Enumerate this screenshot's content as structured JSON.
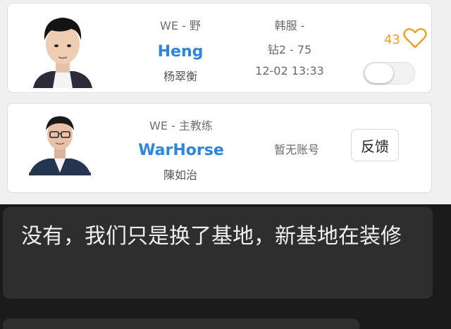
{
  "players": [
    {
      "team_role": "WE - 野",
      "player_id": "Heng",
      "real_name": "杨翠衡",
      "server": "韩服 -",
      "rank": "钻2 - 75",
      "time": "12-02 13:33",
      "likes": "43",
      "like_icon": "heart-outline-icon",
      "toggle_on": false
    },
    {
      "team_role": "WE - 主教练",
      "player_id": "WarHorse",
      "real_name": "陳如治",
      "account_status": "暂无账号",
      "feedback_label": "反馈"
    }
  ],
  "chat": {
    "message": "没有，我们只是换了基地，新基地在装修"
  },
  "colors": {
    "accent_blue": "#2a86e0",
    "like_orange": "#f0a020",
    "chat_bg": "#1b1b1b",
    "bubble_bg": "#2e2e2e"
  }
}
